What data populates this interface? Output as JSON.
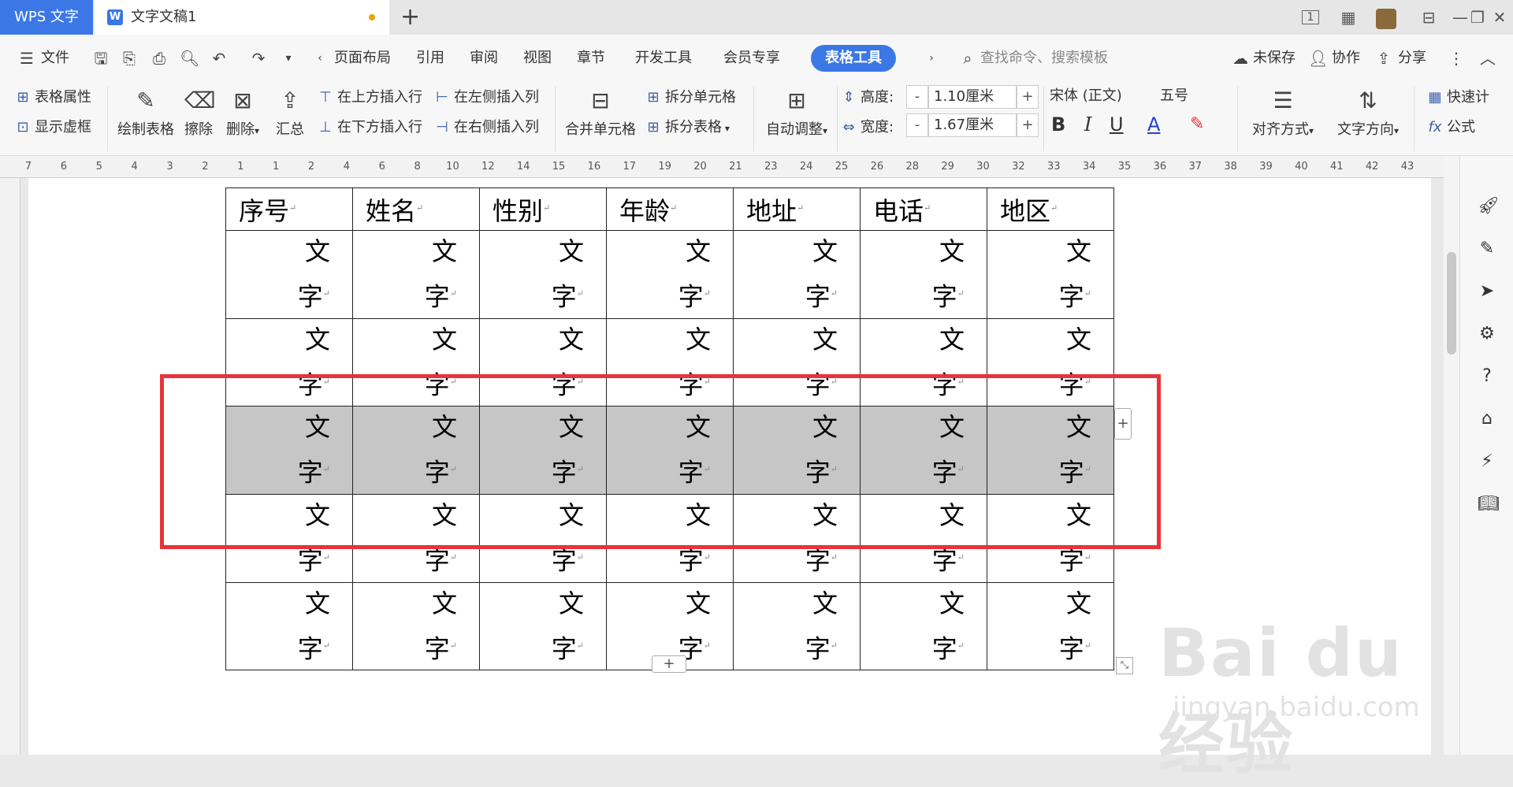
{
  "titlebar": {
    "app_tab": "WPS 文字",
    "doc_tab": "文字文稿1",
    "new_tab": "+",
    "page_indicator": "1"
  },
  "menubar": {
    "file": "文件",
    "items": [
      "页面布局",
      "引用",
      "审阅",
      "视图",
      "章节",
      "开发工具",
      "会员专享"
    ],
    "active_tab": "表格工具",
    "search_placeholder": "查找命令、搜索模板",
    "unsaved": "未保存",
    "collaborate": "协作",
    "share": "分享"
  },
  "ribbon": {
    "table_props": "表格属性",
    "show_gridlines": "显示虚框",
    "draw_table": "绘制表格",
    "erase": "擦除",
    "delete": "删除",
    "summary": "汇总",
    "insert_above": "在上方插入行",
    "insert_below": "在下方插入行",
    "insert_left": "在左侧插入列",
    "insert_right": "在右侧插入列",
    "merge_cells": "合并单元格",
    "split_cells": "拆分单元格",
    "split_table": "拆分表格",
    "auto_adjust": "自动调整",
    "height_label": "高度:",
    "height_value": "1.10厘米",
    "width_label": "宽度:",
    "width_value": "1.67厘米",
    "font_name": "宋体 (正文)",
    "font_size": "五号",
    "align": "对齐方式",
    "text_direction": "文字方向",
    "quick_calc": "快速计",
    "formula": "公式",
    "minus": "-",
    "plus": "+"
  },
  "ruler": {
    "ticks": [
      "7",
      "6",
      "5",
      "4",
      "3",
      "2",
      "1",
      "1",
      "2",
      "4",
      "6",
      "8",
      "10",
      "12",
      "14",
      "15",
      "16",
      "17",
      "19",
      "20",
      "21",
      "23",
      "24",
      "25",
      "26",
      "28",
      "29",
      "30",
      "32",
      "33",
      "34",
      "35",
      "36",
      "37",
      "38",
      "39",
      "40",
      "41",
      "42",
      "43"
    ]
  },
  "table": {
    "headers": [
      "序号",
      "姓名",
      "性别",
      "年龄",
      "地址",
      "电话",
      "地区"
    ],
    "cell_line1": "文",
    "cell_line2": "字",
    "row_count": 5,
    "selected_row_index": 2
  },
  "watermark": {
    "brand": "Bai du 经验",
    "url": "jingyan.baidu.com"
  },
  "colors": {
    "accent": "#3b78e6",
    "highlight_box": "#e8333a",
    "selected_row": "#c6c6c6"
  }
}
